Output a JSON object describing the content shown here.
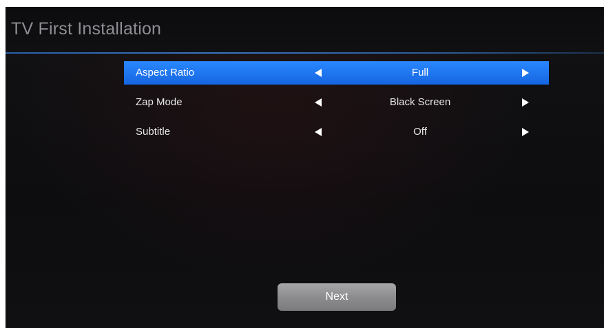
{
  "header": {
    "title": "TV First Installation"
  },
  "menu": {
    "items": [
      {
        "label": "Aspect Ratio",
        "value": "Full",
        "selected": true
      },
      {
        "label": "Zap Mode",
        "value": "Black Screen",
        "selected": false
      },
      {
        "label": "Subtitle",
        "value": "Off",
        "selected": false
      }
    ]
  },
  "footer": {
    "next_label": "Next"
  },
  "colors": {
    "accent": "#1e78f5",
    "background": "#0f0f12",
    "button": "#8d8d90"
  },
  "icons": {
    "left": "arrow-left-icon",
    "right": "arrow-right-icon"
  }
}
